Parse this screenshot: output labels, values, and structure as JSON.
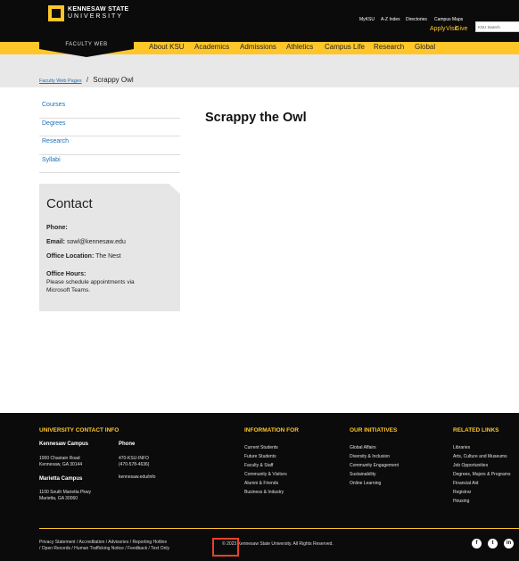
{
  "header": {
    "logo_line1": "KENNESAW STATE",
    "logo_line2": "UNIVERSITY",
    "logo_sub": "FACULTY WEB",
    "utility": [
      "MyKSU",
      "A-Z Index",
      "Directories",
      "Campus Maps"
    ],
    "gold_links": [
      "Apply",
      "Visit",
      "Give"
    ],
    "search_placeholder": "KSU Search",
    "nav": [
      "About KSU",
      "Academics",
      "Admissions",
      "Athletics",
      "Campus Life",
      "Research",
      "Global"
    ]
  },
  "breadcrumb": {
    "parent": "Faculty Web Pages",
    "separator": "/",
    "current": "Scrappy Owl"
  },
  "sidebar": {
    "items": [
      "Courses",
      "Degrees",
      "Research",
      "Syllabi"
    ]
  },
  "main": {
    "title": "Scrappy the Owl"
  },
  "contact": {
    "heading": "Contact",
    "phone_label": "Phone:",
    "email_label": "Email:",
    "email": "sowl@kennesaw.edu",
    "office_label": "Office Location:",
    "office": "The Nest",
    "hours_label": "Office Hours:",
    "hours_line1": "Please schedule appointments via",
    "hours_line2": "Microsoft Teams."
  },
  "footer": {
    "contact_heading": "UNIVERSITY CONTACT INFO",
    "kennesaw_campus": "Kennesaw Campus",
    "kennesaw_addr1": "1000 Chastain Road",
    "kennesaw_addr2": "Kennesaw, GA 30144",
    "phone_heading": "Phone",
    "phone1": "470-KSU-INFO",
    "phone2": "(470-578-4636)",
    "website": "kennesaw.edu/info",
    "marietta_campus": "Marietta Campus",
    "marietta_addr1": "1100 South Marietta Pkwy",
    "marietta_addr2": "Marietta, GA 30060",
    "info_heading": "INFORMATION FOR",
    "info_items": [
      "Current Students",
      "Future Students",
      "Faculty & Staff",
      "Community & Visitors",
      "Alumni & Friends",
      "Business & Industry"
    ],
    "initiatives_heading": "OUR INITIATIVES",
    "initiative_items": [
      "Global Affairs",
      "Diversity & Inclusion",
      "Community Engagement",
      "Sustainability",
      "Online Learning"
    ],
    "related_heading": "RELATED LINKS",
    "related_items": [
      "Libraries",
      "Arts, Culture and Museums",
      "Job Opportunities",
      "Degrees, Majors & Programs",
      "Financial Aid",
      "Registrar",
      "Housing"
    ],
    "legal_line1": "Privacy Statement / Accreditation / Advisories / Reporting Hotline",
    "legal_line2": "/ Open Records / Human Trafficking Notice / Feedback / Text Only",
    "copyright": "© 2023 Kennesaw State University. All Rights Reserved.",
    "social": [
      "f",
      "t",
      "in"
    ]
  },
  "colors": {
    "gold": "#ffc629",
    "black": "#0b0b0b",
    "link": "#1d6fb5",
    "highlight": "#e8412c"
  }
}
